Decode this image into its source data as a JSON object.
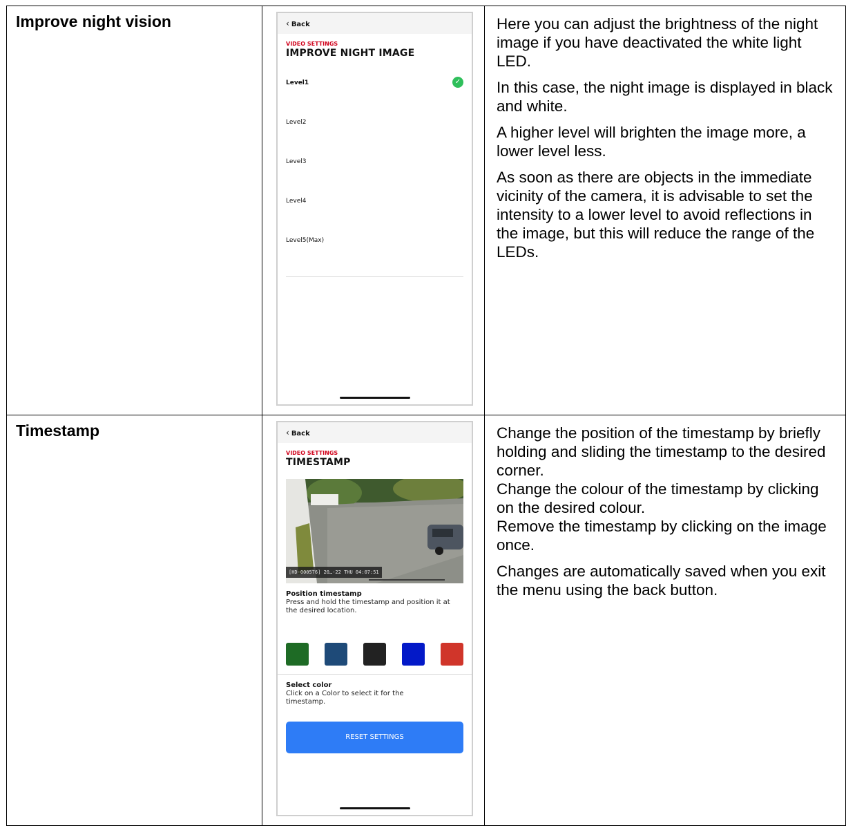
{
  "rows": [
    {
      "feature": "Improve night vision",
      "description": [
        "Here you can adjust the brightness of the night image if you have deactivated the white light LED.",
        "In this case, the night image is displayed in black and white.",
        "A higher level will brighten the image more, a lower level less.",
        "As soon as there are objects in the immediate vicinity of the camera, it is advisable to set the intensity to a lower level to avoid reflections in the image, but this will reduce the range of the LEDs."
      ],
      "phone": {
        "back_label": "Back",
        "section": "VIDEO SETTINGS",
        "title": "IMPROVE NIGHT IMAGE",
        "levels": [
          "Level1",
          "Level2",
          "Level3",
          "Level4",
          "Level5(Max)"
        ],
        "selected_level": "Level1",
        "check_color": "#2fbf5b",
        "check_icon": "check-circle-icon"
      }
    },
    {
      "feature": "Timestamp",
      "description": [
        "Change the position of the timestamp by briefly holding and sliding the timestamp to the desired corner.",
        "Change the colour of the timestamp by clicking on the desired colour.",
        "Remove the timestamp by clicking on the image once.",
        "Changes are automatically saved when you exit the menu using the back button."
      ],
      "phone": {
        "back_label": "Back",
        "section": "VIDEO SETTINGS",
        "title": "TIMESTAMP",
        "timestamp_overlay": "[HD-000576] 20…-22 THU 04:07:51",
        "position_heading": "Position timestamp",
        "position_text": "Press and hold the timestamp and position it at the desired location.",
        "swatch_colors": [
          "#1e6b25",
          "#1e4a78",
          "#222222",
          "#0319c8",
          "#d0352a"
        ],
        "color_heading": "Select color",
        "color_text": "Click on a Color to select it for the timestamp.",
        "reset_label": "RESET SETTINGS",
        "reset_color": "#2e7cf6"
      }
    }
  ]
}
